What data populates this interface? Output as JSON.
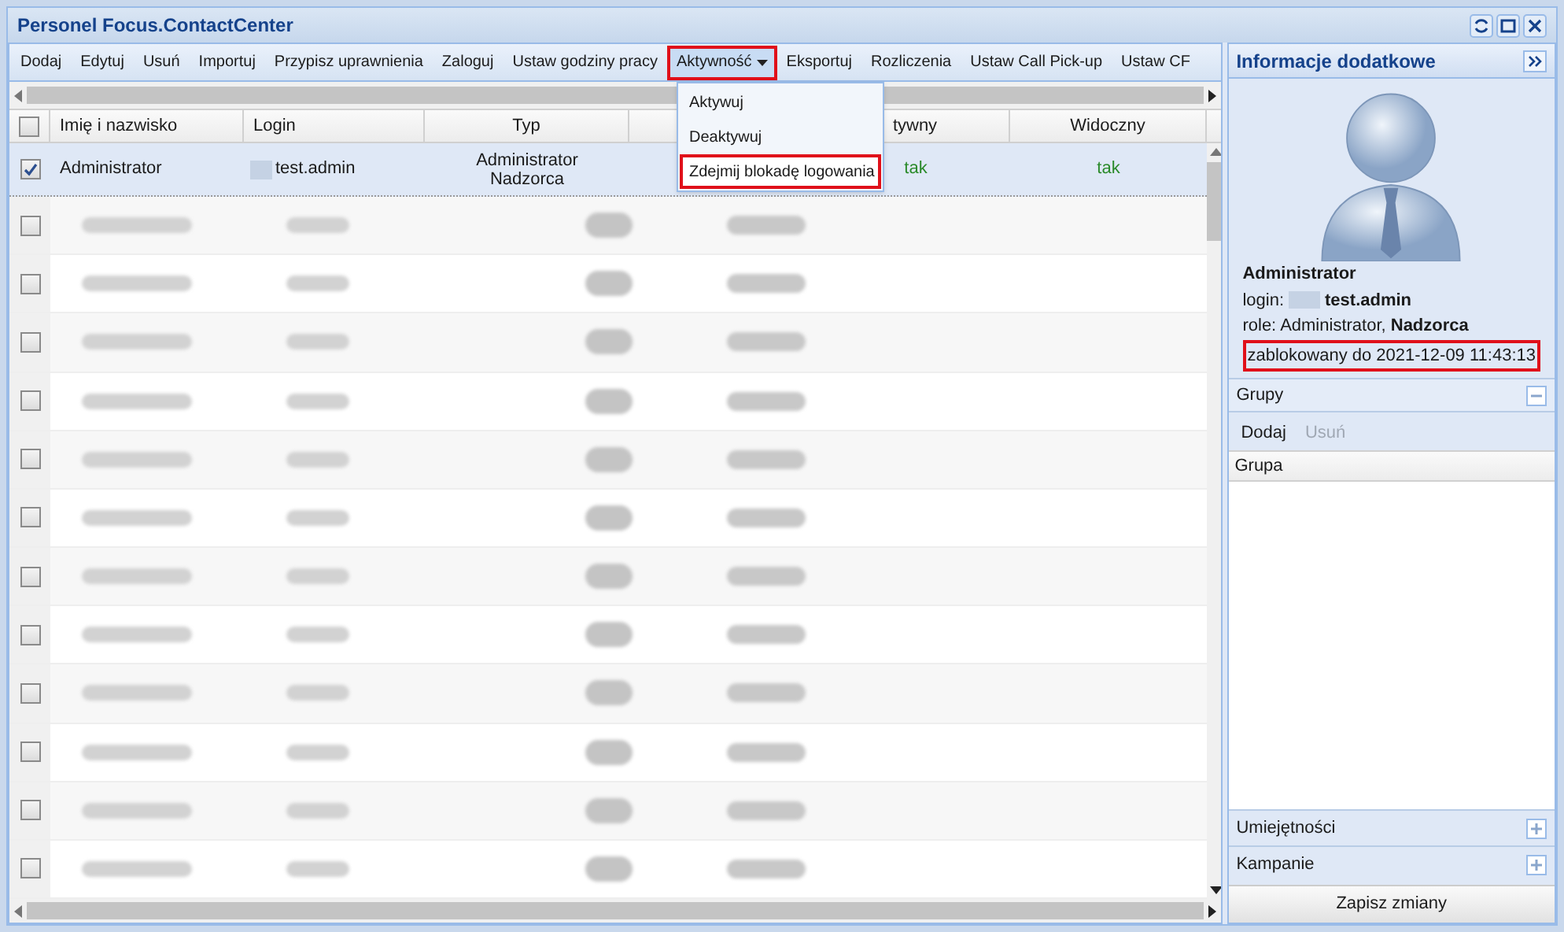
{
  "window": {
    "title": "Personel Focus.ContactCenter"
  },
  "toolbar": [
    {
      "label": "Dodaj",
      "highlighted": false,
      "dropdown": false
    },
    {
      "label": "Edytuj",
      "highlighted": false,
      "dropdown": false
    },
    {
      "label": "Usuń",
      "highlighted": false,
      "dropdown": false
    },
    {
      "label": "Importuj",
      "highlighted": false,
      "dropdown": false
    },
    {
      "label": "Przypisz uprawnienia",
      "highlighted": false,
      "dropdown": false
    },
    {
      "label": "Zaloguj",
      "highlighted": false,
      "dropdown": false
    },
    {
      "label": "Ustaw godziny pracy",
      "highlighted": false,
      "dropdown": false
    },
    {
      "label": "Aktywność",
      "highlighted": true,
      "dropdown": true
    },
    {
      "label": "Eksportuj",
      "highlighted": false,
      "dropdown": false
    },
    {
      "label": "Rozliczenia",
      "highlighted": false,
      "dropdown": false
    },
    {
      "label": "Ustaw Call Pick-up",
      "highlighted": false,
      "dropdown": false
    },
    {
      "label": "Ustaw CF",
      "highlighted": false,
      "dropdown": false
    }
  ],
  "dropdown_menu": [
    {
      "label": "Aktywuj",
      "highlighted": false
    },
    {
      "label": "Deaktywuj",
      "highlighted": false
    },
    {
      "label": "Zdejmij blokadę logowania",
      "highlighted": true
    }
  ],
  "table": {
    "header_checked": false,
    "columns": [
      "Imię i nazwisko",
      "Login",
      "Typ",
      "",
      "tywny",
      "Widoczny"
    ],
    "first_row": {
      "checked": true,
      "selected": true,
      "name": "Administrator",
      "login": "test.admin",
      "type": "Administrator Nadzorca",
      "column_5": "tak",
      "visible": "tak"
    },
    "blurred_rows": [
      {
        "checked": false
      },
      {
        "checked": false
      },
      {
        "checked": false
      },
      {
        "checked": false
      },
      {
        "checked": false
      },
      {
        "checked": false
      },
      {
        "checked": false
      },
      {
        "checked": false
      },
      {
        "checked": false
      },
      {
        "checked": false
      },
      {
        "checked": false
      },
      {
        "checked": false
      }
    ]
  },
  "side_panel": {
    "title": "Informacje dodatkowe",
    "name": "Administrator",
    "login_label": "login:",
    "login": "test.admin",
    "roles": "role: Administrator, **Nadzorca**",
    "blocked": {
      "text": "zablokowany do 2021-12-09 11:43:13",
      "highlighted": true
    },
    "groups": {
      "title": "Grupy",
      "expanded": true,
      "buttons": [
        {
          "label": "Dodaj",
          "disabled": false
        },
        {
          "label": "Usuń",
          "disabled": true
        }
      ],
      "column": "Grupa"
    },
    "sections": [
      {
        "title": "Umiejętności",
        "expanded": false
      },
      {
        "title": "Kampanie",
        "expanded": false
      }
    ],
    "save_button": "Zapisz zmiany"
  }
}
